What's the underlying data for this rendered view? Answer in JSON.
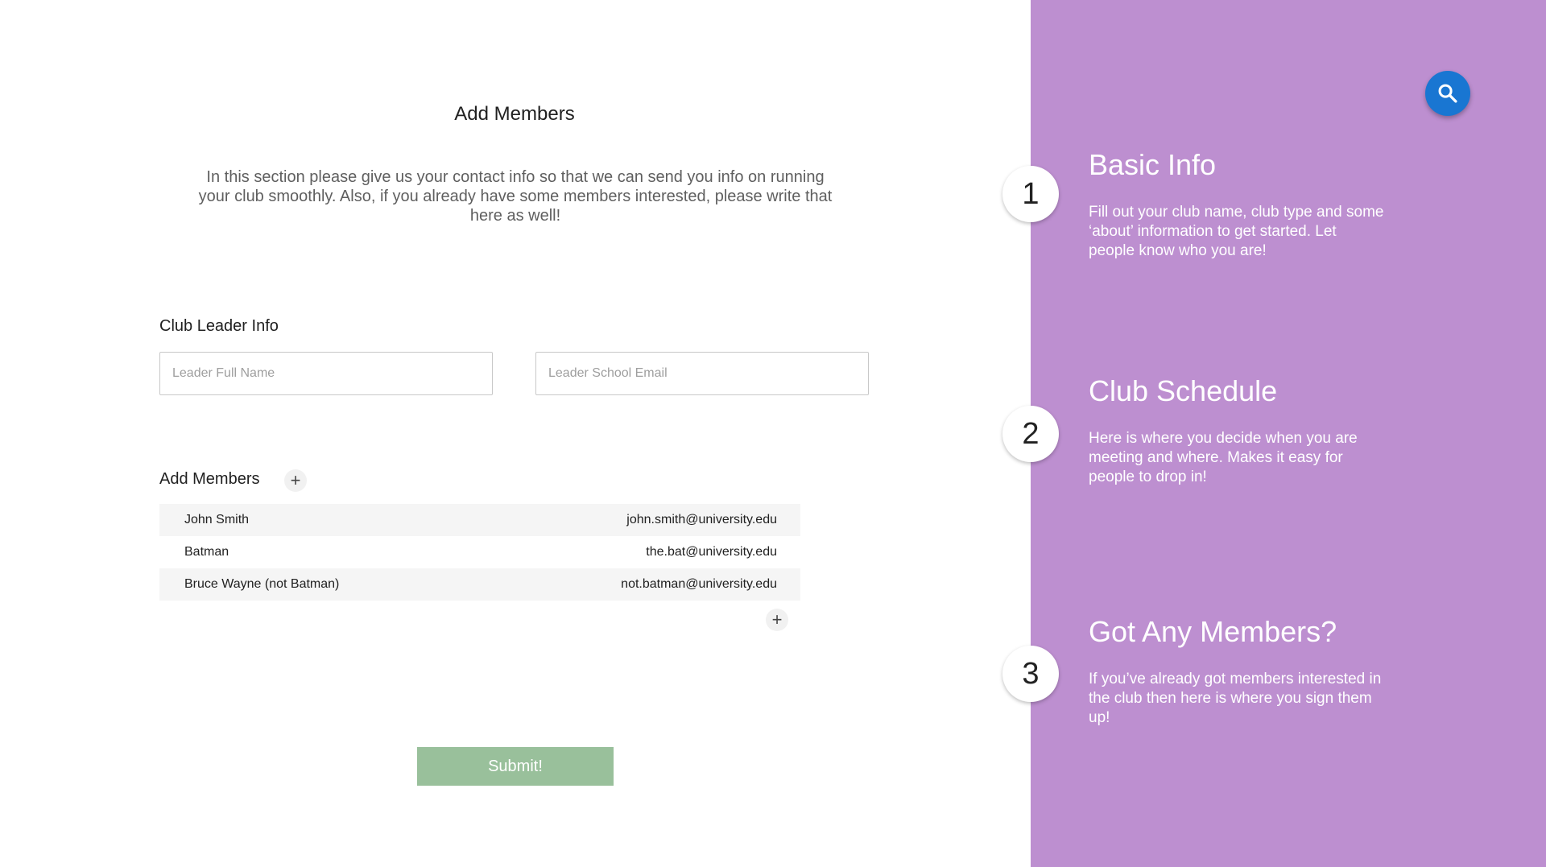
{
  "page": {
    "title": "Add Members",
    "intro": "In this section please give us your contact info so that we can send you info on running your club smoothly. Also, if you already have some members interested, please write that here as well!"
  },
  "leader": {
    "section_label": "Club Leader Info",
    "name_placeholder": "Leader Full Name",
    "email_placeholder": "Leader School Email"
  },
  "members": {
    "section_label": "Add Members",
    "add_symbol": "+",
    "rows": [
      {
        "name": "John Smith",
        "email": "john.smith@university.edu"
      },
      {
        "name": "Batman",
        "email": "the.bat@university.edu"
      },
      {
        "name": "Bruce Wayne (not Batman)",
        "email": "not.batman@university.edu"
      }
    ]
  },
  "submit_label": "Submit!",
  "steps": [
    {
      "number": "1",
      "title": "Basic Info",
      "description": "Fill out your club name, club type and some ‘about’ information to get started. Let people know who you are!"
    },
    {
      "number": "2",
      "title": "Club Schedule",
      "description": "Here is where you decide when you are meeting and where. Makes it easy for people to drop in!"
    },
    {
      "number": "3",
      "title": "Got Any Members?",
      "description": "If you’ve already got members interested in the club then here is where you sign them up!"
    }
  ],
  "icons": {
    "search": "search-icon",
    "add": "plus-icon"
  },
  "colors": {
    "panel": "#bd8fd0",
    "submit": "#99c09b",
    "fab": "#1976d2"
  }
}
